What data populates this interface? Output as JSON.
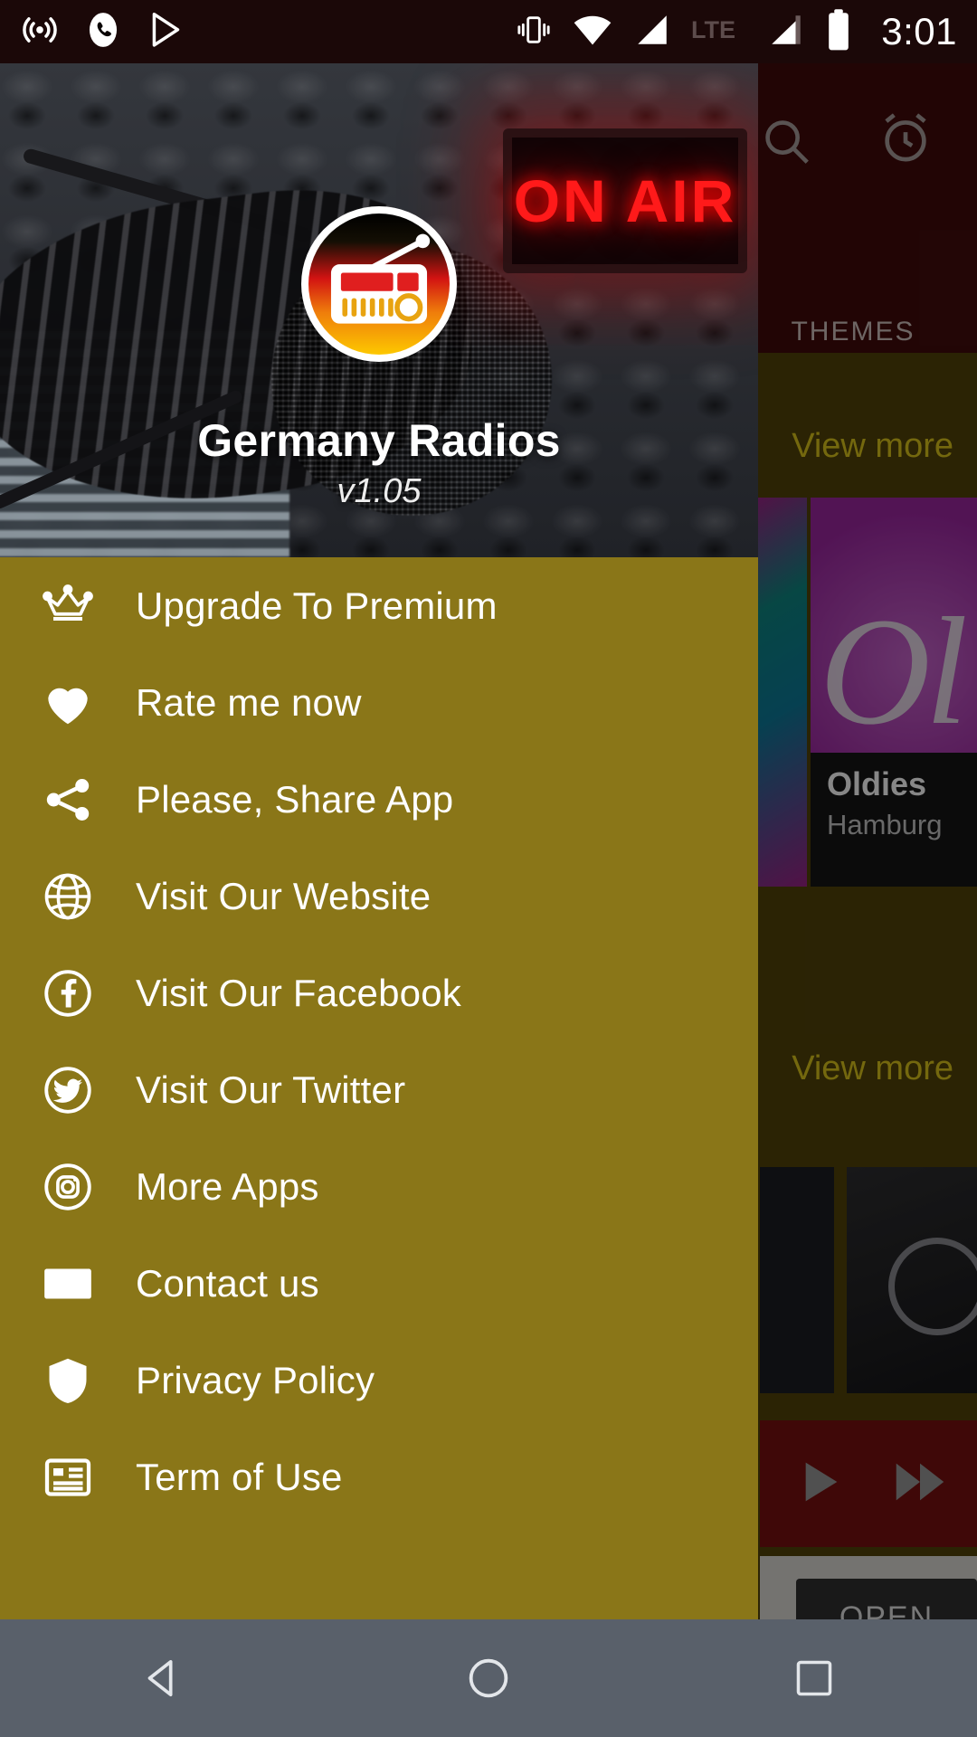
{
  "status_bar": {
    "time": "3:01",
    "left_icons": [
      "broadcast-icon",
      "phone-icon",
      "play-store-icon"
    ],
    "right_icons": [
      "vibrate-icon",
      "wifi-icon",
      "signal-icon",
      "lte-label",
      "signal-2-icon",
      "battery-icon"
    ],
    "network_label": "LTE",
    "background_color": "#1b0808"
  },
  "drawer": {
    "background_color": "#8a7618",
    "header": {
      "app_title": "Germany Radios",
      "version": "v1.05",
      "logo_name": "germany-radios-logo",
      "backdrop_sign_text": "ON AIR"
    },
    "items": [
      {
        "icon": "crown-icon",
        "label": "Upgrade To Premium"
      },
      {
        "icon": "heart-icon",
        "label": "Rate me now"
      },
      {
        "icon": "share-icon",
        "label": "Please, Share App"
      },
      {
        "icon": "globe-icon",
        "label": "Visit Our Website"
      },
      {
        "icon": "facebook-icon",
        "label": "Visit Our Facebook"
      },
      {
        "icon": "twitter-icon",
        "label": "Visit Our Twitter"
      },
      {
        "icon": "instagram-icon",
        "label": "More Apps"
      },
      {
        "icon": "mail-icon",
        "label": "Contact us"
      },
      {
        "icon": "shield-icon",
        "label": "Privacy Policy"
      },
      {
        "icon": "list-icon",
        "label": "Term of Use"
      }
    ]
  },
  "app_behind": {
    "appbar": {
      "background_color": "#3c0a0a",
      "search_icon": "search-icon",
      "alarm_icon": "alarm-clock-icon"
    },
    "tabs": [
      {
        "label": "THEMES"
      }
    ],
    "sections": [
      {
        "view_more_label": "View more"
      },
      {
        "view_more_label": "View more"
      }
    ],
    "cards": [
      {
        "title": "Oldies",
        "subtitle": "Hamburg"
      }
    ],
    "player": {
      "play_icon": "play-icon",
      "next_icon": "fast-forward-icon",
      "background_color": "#6d0f0f"
    },
    "install_banner": {
      "open_label": "OPEN"
    }
  },
  "nav_bar": {
    "background_color": "#59606a",
    "buttons": [
      {
        "name": "back-button",
        "icon": "triangle-left-icon"
      },
      {
        "name": "home-button",
        "icon": "circle-icon"
      },
      {
        "name": "recents-button",
        "icon": "square-icon"
      }
    ]
  }
}
